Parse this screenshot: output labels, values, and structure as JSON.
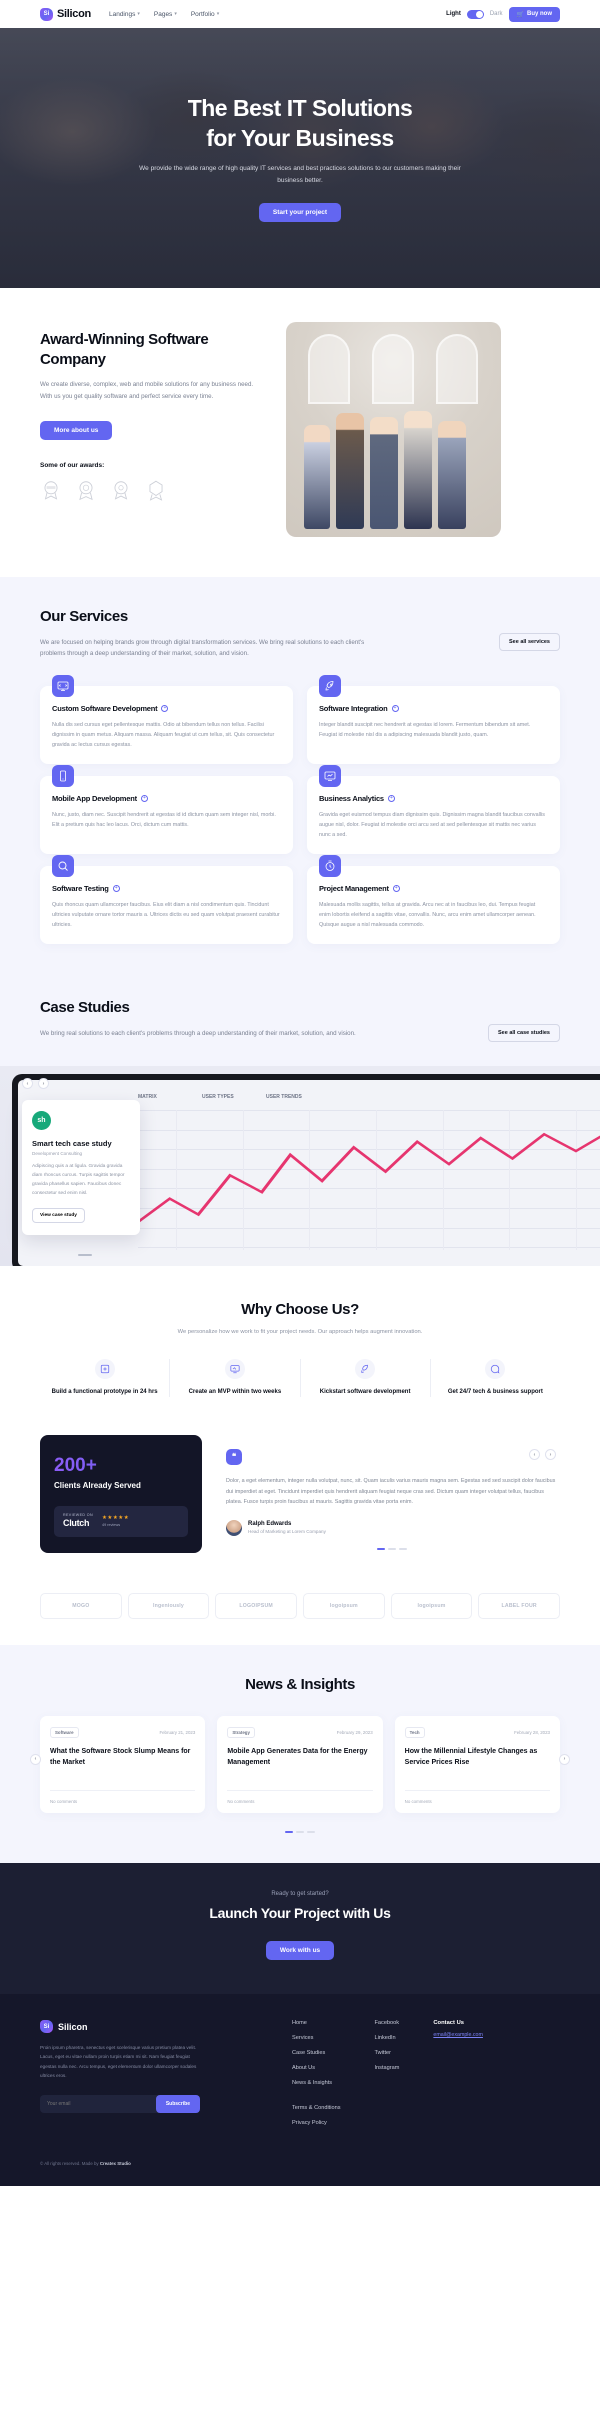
{
  "nav": {
    "brand": "Silicon",
    "brand_mark": "Si",
    "links": [
      {
        "label": "Landings",
        "caret": "▾"
      },
      {
        "label": "Pages",
        "caret": "▾"
      },
      {
        "label": "Portfolio",
        "caret": "▾"
      }
    ],
    "mode_light": "Light",
    "mode_dark": "Dark",
    "buy_label": "Buy now",
    "cart_icon": "🛒"
  },
  "hero": {
    "title_line1": "The Best IT Solutions",
    "title_line2": "for Your Business",
    "subtitle": "We provide the wide range of high quality IT services and best practices solutions to our customers making their business better.",
    "cta": "Start your project"
  },
  "award": {
    "title": "Award-Winning Software Company",
    "body": "We create diverse, complex, web and mobile solutions for any business need. With us you get quality software and perfect service every time.",
    "cta": "More about us",
    "awards_label": "Some of our awards:",
    "badges": [
      "award-badge-1",
      "award-badge-2",
      "award-badge-3",
      "award-badge-4"
    ]
  },
  "services": {
    "title": "Our Services",
    "subtitle": "We are focused on helping brands grow through digital transformation services. We bring real solutions to each client's problems through a deep understanding of their market, solution, and vision.",
    "see_all": "See all services",
    "cards": [
      {
        "icon": "code-screen-icon",
        "title": "Custom Software Development",
        "body": "Nulla dis sed cursus eget pellentesque mattis. Odio at bibendum tellus non tellus. Facilisi dignissim in quam metus. Aliquam massa. Aliquam feugiat ut cum tellus, sit. Quis consectetur gravida ac lectus cursus egestas."
      },
      {
        "icon": "rocket-icon",
        "title": "Software Integration",
        "body": "Integer blandit suscipit nec hendrerit at egestas id lorem. Fermentum bibendum sit amet. Feugiat id molestie nisl dis a adipiscing malesuada blandit justo, quam."
      },
      {
        "icon": "mobile-icon",
        "title": "Mobile App Development",
        "body": "Nunc, justo, diam nec. Suscipit hendrerit at egestas id id dictum quam sem integer nisl, morbi. Elit a pretium quis hac leo lacus. Orci, dictum cum mattis."
      },
      {
        "icon": "chart-monitor-icon",
        "title": "Business Analytics",
        "body": "Gravida eget euismod tempus diam dignissim quis. Dignissim magna blandit faucibus convallis augue nisl, dolor. Feugiat id molestie orci arcu sed at sed pellentesque sit mattis nec varius nunc a sed."
      },
      {
        "icon": "search-testing-icon",
        "title": "Software Testing",
        "body": "Quis rhoncus quam ullamcorper faucibus. Eius elit diam a nisl condimentum quis. Tincidunt ultricies vulputate ornare tortor mauris a. Ultrices dictis eu sed quam volutpat praesent curabitur ultricies."
      },
      {
        "icon": "stopwatch-icon",
        "title": "Project Management",
        "body": "Malesuada mollis sagittis, tellus at gravida. Arcu nec at in faucibus leo, dui. Tempus feugiat enim lobortis eleifend a sagittis vitae, convallis. Nunc, arcu enim amet ullamcorper aenean. Quisque augue a nisl malesuada commodo."
      }
    ]
  },
  "case_studies": {
    "title": "Case Studies",
    "subtitle": "We bring real solutions to each client's problems through a deep understanding of their market, solution, and vision.",
    "see_all": "See all case studies",
    "card": {
      "avatar_initials": "sh",
      "title": "Smart tech case study",
      "subtitle": "Development Consulting",
      "body": "Adipiscing quis a at ligula. Gravida gravida diam rhoncus curcus. Turpis sagittis tempor gravida phasellus sapien. Faucibus donec consectetur sed enim nisl.",
      "cta": "View case study"
    },
    "screen_cols": [
      "MATRIX",
      "USER TYPES",
      "USER TRENDS"
    ],
    "arrows": {
      "prev": "‹",
      "next": "›"
    }
  },
  "why": {
    "title": "Why Choose Us?",
    "subtitle": "We personalize how we work to fit your project needs. Our approach helps augment innovation.",
    "items": [
      {
        "icon": "prototype-icon",
        "text": "Build a functional prototype in 24 hrs"
      },
      {
        "icon": "mvp-monitor-icon",
        "text": "Create an MVP within two weeks"
      },
      {
        "icon": "rocket-launch-icon",
        "text": "Kickstart software development"
      },
      {
        "icon": "support-chat-icon",
        "text": "Get 24/7 tech & business support"
      }
    ]
  },
  "stats": {
    "number": "200+",
    "label": "Clients Already Served",
    "clutch": {
      "reviewed_on": "REVIEWED ON",
      "name": "Clutch",
      "stars": "★★★★★",
      "reviews": "49 reviews"
    },
    "quote": {
      "mark": "❝",
      "text": "Dolor, a eget elementum, integer nulla volutpat, nunc, sit. Quam iaculis varius mauris magna sem. Egestas sed sed suscipit dolor faucibus dui imperdiet at eget. Tincidunt imperdiet quis hendrerit aliquam feugiat neque cras sed. Dictum quam integer volutpat tellus, faucibus platea. Fusce turpis proin faucibus at mauris. Sagittis gravida vitae porta enim.",
      "name": "Ralph Edwards",
      "role": "Head of Marketing at Lorem Company",
      "prev": "‹",
      "next": "›"
    }
  },
  "logos": [
    {
      "name": "logo-mogo",
      "text": "MOGO"
    },
    {
      "name": "logo-ingeniously",
      "text": "Ingeniously"
    },
    {
      "name": "logo-logoipsum",
      "text": "LOGOIPSUM"
    },
    {
      "name": "logo-logoipsum-2",
      "text": "logoipsum"
    },
    {
      "name": "logo-logoipsum-3",
      "text": "logoipsum"
    },
    {
      "name": "logo-label-four",
      "text": "LABEL FOUR"
    }
  ],
  "news": {
    "title": "News & Insights",
    "prev": "‹",
    "next": "›",
    "cards": [
      {
        "tag": "Software",
        "date": "February 21, 2023",
        "title": "What the Software Stock Slump Means for the Market",
        "comments": "No comments"
      },
      {
        "tag": "Strategy",
        "date": "February 29, 2023",
        "title": "Mobile App Generates Data for the Energy Management",
        "comments": "No comments"
      },
      {
        "tag": "Tech",
        "date": "February 28, 2023",
        "title": "How the Millennial Lifestyle Changes as Service Prices Rise",
        "comments": "No comments"
      }
    ]
  },
  "cta": {
    "kicker": "Ready to get started?",
    "title": "Launch Your Project with Us",
    "button": "Work with us"
  },
  "footer": {
    "brand": "Silicon",
    "brand_mark": "Si",
    "about": "Proin ipsum pharetra, senectus eget scelerisque varius pretium platea velit. Lacus, eget eu vitae nullam proin turpis etiam mi sit. Nam feugiat feugiat egestas nulla nec. Arcu tempus, eget elementum dolor ullamcorper sodales ultrices eros.",
    "email_placeholder": "Your email",
    "subscribe": "Subscribe",
    "nav_links": [
      "Home",
      "Services",
      "Case Studies",
      "About Us",
      "News & Insights"
    ],
    "legal_links": [
      "Terms & Conditions",
      "Privacy Policy"
    ],
    "social_links": [
      "Facebook",
      "LinkedIn",
      "Twitter",
      "Instagram"
    ],
    "contact_title": "Contact Us",
    "contact_email": "email@example.com",
    "copyright_prefix": "© All rights reserved. Made by ",
    "copyright_brand": "Createx Studio"
  }
}
